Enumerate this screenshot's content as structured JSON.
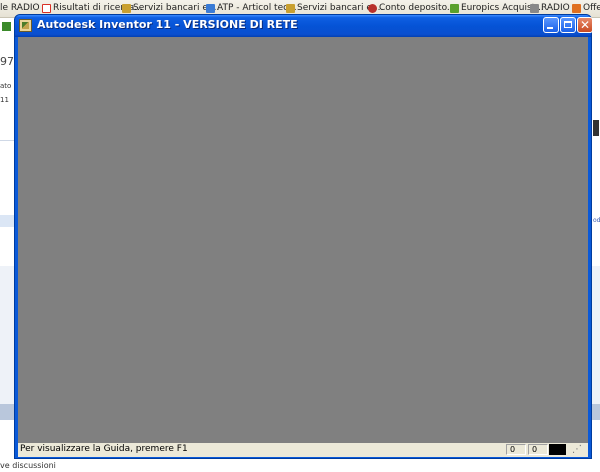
{
  "browser": {
    "bookmarks": [
      {
        "label": "le RADIO",
        "icon": "radio-icon",
        "color": "#ffffff"
      },
      {
        "label": "Risultati di ricerca...",
        "icon": "gmail-icon",
        "color": "#d93025"
      },
      {
        "label": "Servizi bancari e ...",
        "icon": "bank-icon",
        "color": "#c9a030"
      },
      {
        "label": "ATP - Articol tec...",
        "icon": "atp-icon",
        "color": "#3a7bd5"
      },
      {
        "label": "Servizi bancari e ...",
        "icon": "bank-icon",
        "color": "#c9a030"
      },
      {
        "label": "Conto deposito...",
        "icon": "deposit-icon",
        "color": "#b8302a"
      },
      {
        "label": "Europics Acquist...",
        "icon": "europics-icon",
        "color": "#5aa02c"
      },
      {
        "label": "RADIO",
        "icon": "radio-icon",
        "color": "#888888"
      },
      {
        "label": "Offer",
        "icon": "offer-icon",
        "color": "#e07020"
      }
    ],
    "fragments": {
      "left_number": "97",
      "left_text1": "ato",
      "left_text2": "11",
      "right_link": "od",
      "bottom_text": "ve discussioni"
    }
  },
  "window": {
    "title": "Autodesk Inventor 11 - VERSIONE DI RETE",
    "status_text": "Per visualizzare la Guida, premere F1",
    "status_fields": [
      "0",
      "0"
    ],
    "colors": {
      "titlebar": "#0553d6",
      "client_area": "#808080",
      "statusbar": "#ece9d8"
    }
  }
}
